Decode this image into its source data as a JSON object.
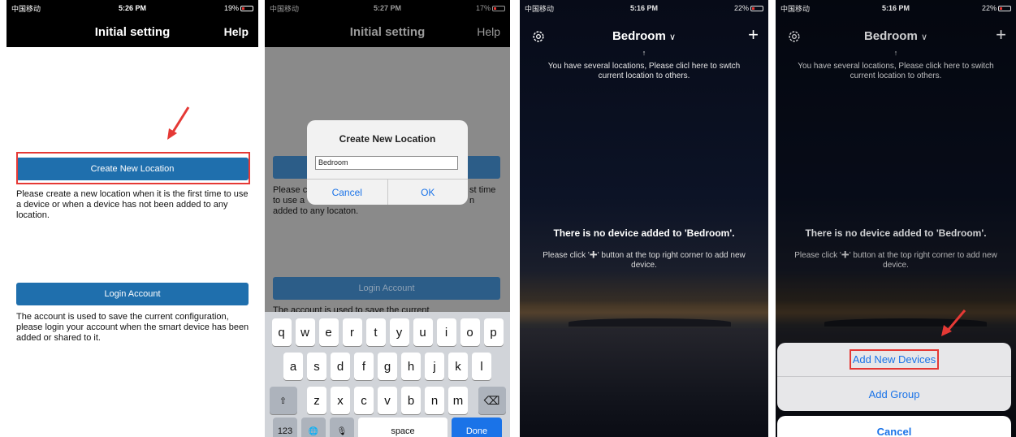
{
  "status": {
    "carrier": "中国移动",
    "p1_time": "5:26 PM",
    "p1_right": "19%",
    "p2_time": "5:27 PM",
    "p2_right": "17%",
    "p3_time": "5:16 PM",
    "p3_right": "22%",
    "p4_time": "5:16 PM",
    "p4_right": "22%"
  },
  "setting": {
    "title": "Initial setting",
    "help": "Help",
    "create_button": "Create New Location",
    "create_desc": "Please create a new location when it is the first time to use a device or when a device has not been added to any location.",
    "login_button": "Login Account",
    "login_desc": "The account is used to save the current configuration, please login your account when the smart device has been added or shared to it."
  },
  "setting_bg": {
    "create_desc_left": "Please c",
    "create_desc_left2": "to use a",
    "create_desc_right": "st time",
    "create_desc_right2": "n",
    "create_desc_line3": "added to any locaton.",
    "login_desc_partial": "The account is used to save the current"
  },
  "dialog": {
    "title": "Create New Location",
    "value": "Bedroom",
    "cancel": "Cancel",
    "ok": "OK"
  },
  "keyboard": {
    "row1": [
      "q",
      "w",
      "e",
      "r",
      "t",
      "y",
      "u",
      "i",
      "o",
      "p"
    ],
    "row2": [
      "a",
      "s",
      "d",
      "f",
      "g",
      "h",
      "j",
      "k",
      "l"
    ],
    "row3": [
      "z",
      "x",
      "c",
      "v",
      "b",
      "n",
      "m"
    ],
    "shift": "⇧",
    "delete": "⌫",
    "numbers": "123",
    "globe": "🌐",
    "mic": "🎙",
    "space": "space",
    "done": "Done"
  },
  "home": {
    "location": "Bedroom",
    "chevron": "∨",
    "add": "+",
    "hint_arrow": "↑",
    "hint_p3": "You have several locations, Please clicl here to swtch current location to others.",
    "hint_p4": "You have several locations, Please click here to switch current location to others.",
    "nodev_title": "There is no device added to 'Bedroom'.",
    "nodev_pre": "Please click '",
    "nodev_plus": "+",
    "nodev_post": "' button at the top right corner to add new device."
  },
  "sheet": {
    "add_devices": "Add New Devices",
    "add_group": "Add Group",
    "cancel": "Cancel"
  },
  "colors": {
    "accent_blue": "#1f6fad",
    "ios_blue": "#1a73e8",
    "highlight_red": "#e53935"
  }
}
